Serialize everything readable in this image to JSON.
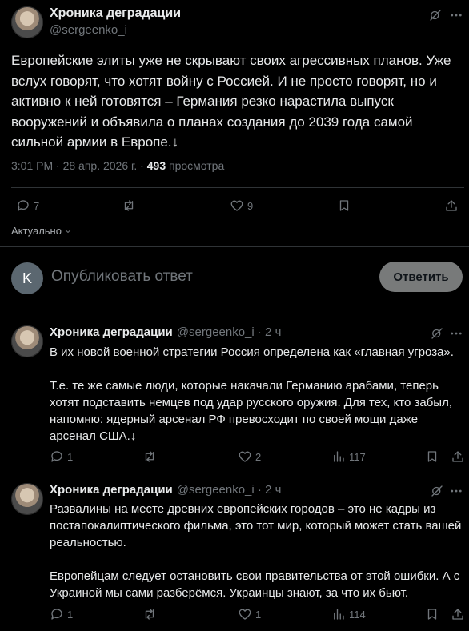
{
  "main_tweet": {
    "author_name": "Хроника деградации",
    "author_handle": "@sergeenko_i",
    "text": "Европейские элиты уже не скрывают своих агрессивных планов. Уже вслух говорят, что хотят войну с Россией. И не просто говорят, но и активно к ней готовятся – Германия резко нарастила выпуск вооружений и объявила о планах создания до 2039 года самой сильной армии в Европе.↓",
    "time": "3:01 PM · 28 апр. 2026 г. · ",
    "views_count": "493",
    "views_label": " просмотра",
    "replies": "7",
    "likes": "9",
    "sort_label": "Актуально"
  },
  "composer": {
    "avatar_letter": "K",
    "placeholder": "Опубликовать ответ",
    "reply_button": "Ответить"
  },
  "replies": [
    {
      "author_name": "Хроника деградации",
      "author_handle": "@sergeenko_i · 2 ч",
      "text": "В их новой военной стратегии Россия определена как «главная угроза».\n\nТ.е. те же самые люди, которые накачали Германию арабами, теперь хотят подставить немцев под удар русского оружия. Для тех, кто забыл, напомню: ядерный арсенал РФ превосходит по своей мощи даже арсенал США.↓",
      "replies": "1",
      "likes": "2",
      "views": "117"
    },
    {
      "author_name": "Хроника деградации",
      "author_handle": "@sergeenko_i · 2 ч",
      "text": "Развалины на месте древних европейских городов – это не кадры из постапокалиптического фильма, это тот мир, который может стать вашей реальностью.\n\nЕвропейцам следует остановить свои правительства от этой ошибки. А с Украиной мы сами разберёмся. Украинцы знают, за что их бьют.",
      "replies": "1",
      "likes": "1",
      "views": "114"
    }
  ]
}
